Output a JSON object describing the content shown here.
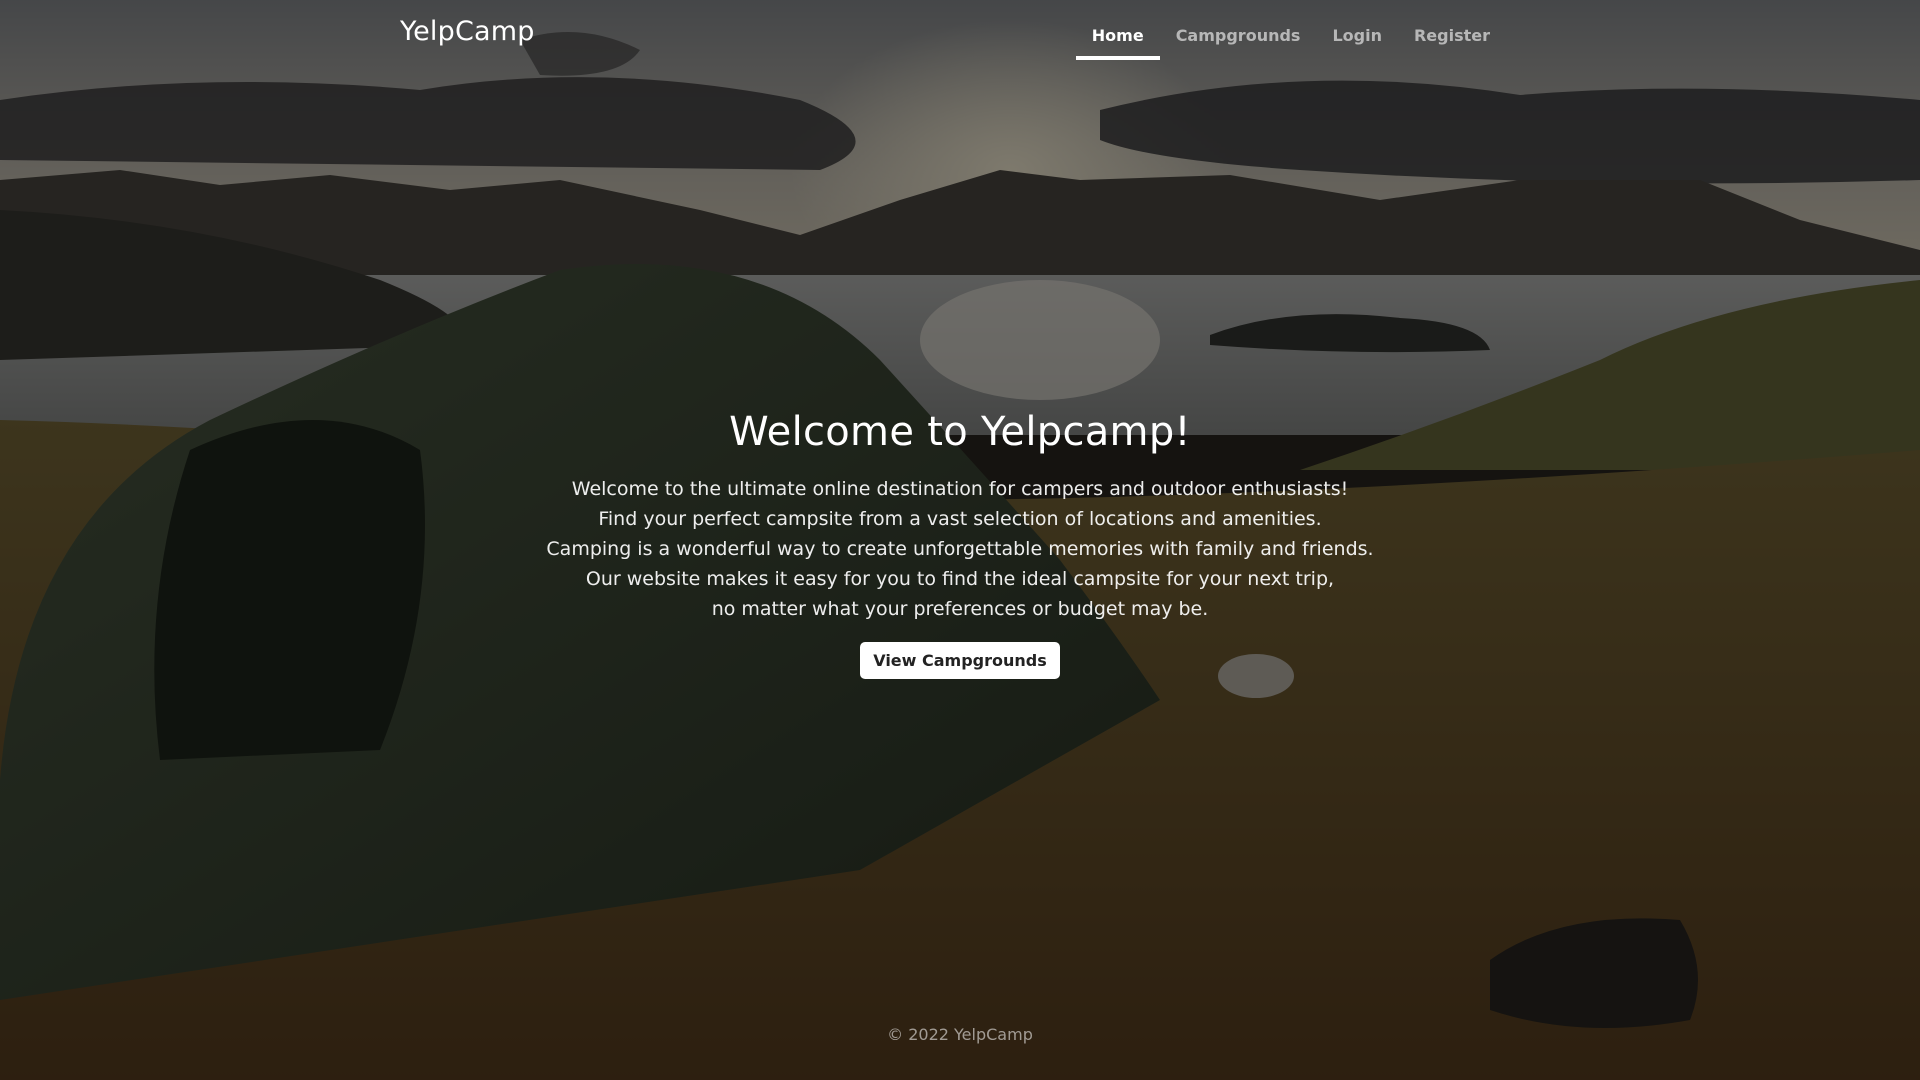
{
  "header": {
    "brand": "YelpCamp",
    "nav": [
      {
        "label": "Home",
        "active": true
      },
      {
        "label": "Campgrounds",
        "active": false
      },
      {
        "label": "Login",
        "active": false
      },
      {
        "label": "Register",
        "active": false
      }
    ]
  },
  "hero": {
    "title": "Welcome to Yelpcamp!",
    "lines": [
      "Welcome to the ultimate online destination for campers and outdoor enthusiasts!",
      "Find your perfect campsite from a vast selection of locations and amenities.",
      "Camping is a wonderful way to create unforgettable memories with family and friends.",
      "Our website makes it easy for you to find the ideal campsite for your next trip,",
      "no matter what your preferences or budget may be."
    ],
    "button_label": "View Campgrounds"
  },
  "footer": {
    "text": "© 2022 YelpCamp"
  }
}
